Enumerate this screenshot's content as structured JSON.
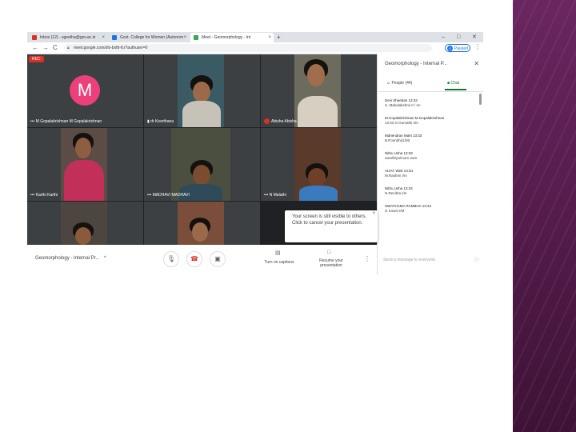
{
  "browser": {
    "tabs": [
      {
        "label": "Inbox (12) - sgeetha@gov.ac.in",
        "favicon_color": "#d93025"
      },
      {
        "label": "Govt. College for Women (Autonom",
        "favicon_color": "#1a73e8"
      },
      {
        "label": "Meet - Geomorphology - Int",
        "favicon_color": "#34a853"
      }
    ],
    "new_tab_label": "+",
    "window_controls": [
      "–",
      "□",
      "✕"
    ],
    "nav": {
      "back": "←",
      "forward": "→",
      "reload": "C"
    },
    "url": "meet.google.com/sfs-bxfd-fcr?authuser=0",
    "profile_initial": "G",
    "profile_label": "Paused",
    "menu_label": "⋮"
  },
  "meeting": {
    "rec_label": "REC",
    "tiles": [
      {
        "name": "M Gopalakrishnan M Gopalakrishnan",
        "avatar_letter": "M"
      },
      {
        "name": "dr Keerthana"
      },
      {
        "name": "Abisha Abisha"
      },
      {
        "name": "Karthi Karthi"
      },
      {
        "name": "MADHAVI MADHAVI"
      },
      {
        "name": "N Malathi"
      },
      {
        "name": ""
      },
      {
        "name": ""
      }
    ],
    "tooltip": {
      "text": "Your screen is still visible to others. Click to cancel your presentation.",
      "close": "×"
    }
  },
  "bottom": {
    "meeting_name": "Geomorphology - Internal Pr...",
    "chevron": "^",
    "captions_label": "Turn on captions",
    "resume_label": "Resume your presentation",
    "more_label": "⋮"
  },
  "chat": {
    "title": "Geomorphology - Internal P...",
    "close": "✕",
    "people_tab": "People (44)",
    "chat_tab": "Chat",
    "messages": [
      {
        "who": "Devi Sheeban  13:32",
        "text": "S. Mahalakshmi II / nn"
      },
      {
        "who": "M.Gopalakrishnan M.Gopalakrishnan",
        "text": "13:33 G.Gomathi I/m"
      },
      {
        "who": "Mahendran Mahi  13:33",
        "text": "B.Ponndhi(1/M)"
      },
      {
        "who": "Nithu Usha  13:33",
        "text": "Sandhiya/morn eam"
      },
      {
        "who": "VIJAY Web  13:34",
        "text": "M.Rashmi I/m"
      },
      {
        "who": "Nithu Usha  13:34",
        "text": "N.Renitha I/m"
      },
      {
        "who": "SWATHAMA RAMBHA  13:34",
        "text": "G Kowsi I/M"
      }
    ],
    "input_placeholder": "Send a message to everyone",
    "send_icon": "▷"
  },
  "colors": {
    "slide_band": "#5a1e4f",
    "meet_bg": "#202124",
    "rec_red": "#d93025",
    "avatar_pink": "#ec407a",
    "chat_green": "#137333"
  }
}
